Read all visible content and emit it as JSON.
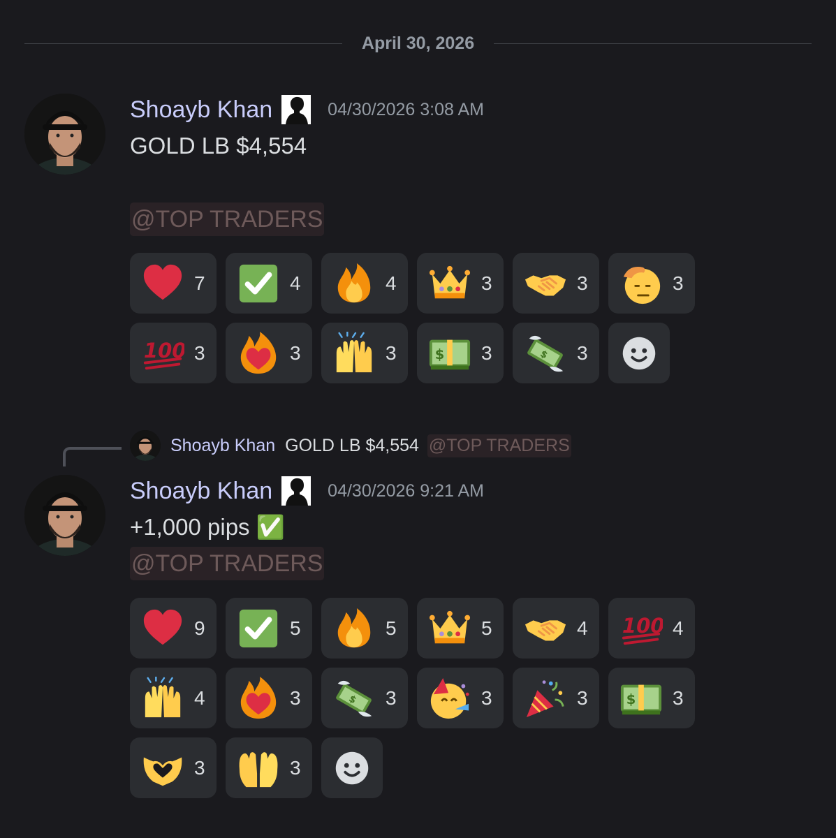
{
  "divider": {
    "date": "April 30, 2026"
  },
  "messages": [
    {
      "author": "Shoayb Khan",
      "timestamp": "04/30/2026 3:08 AM",
      "content": "GOLD LB $4,554",
      "mention": "@TOP TRADERS",
      "reactions": [
        {
          "emoji": "heart",
          "count": "7"
        },
        {
          "emoji": "check-mark",
          "count": "4"
        },
        {
          "emoji": "fire",
          "count": "4"
        },
        {
          "emoji": "crown",
          "count": "3"
        },
        {
          "emoji": "handshake",
          "count": "3"
        },
        {
          "emoji": "saluting-face",
          "count": "3"
        },
        {
          "emoji": "hundred-points",
          "count": "3"
        },
        {
          "emoji": "heart-on-fire",
          "count": "3"
        },
        {
          "emoji": "raising-hands",
          "count": "3"
        },
        {
          "emoji": "dollar-banknote",
          "count": "3"
        },
        {
          "emoji": "money-with-wings",
          "count": "3"
        }
      ]
    },
    {
      "reply": {
        "author": "Shoayb Khan",
        "content": "GOLD LB $4,554",
        "mention": "@TOP TRADERS"
      },
      "author": "Shoayb Khan",
      "timestamp": "04/30/2026 9:21 AM",
      "content": "+1,000 pips ✅",
      "mention": "@TOP TRADERS",
      "reactions": [
        {
          "emoji": "heart",
          "count": "9"
        },
        {
          "emoji": "check-mark",
          "count": "5"
        },
        {
          "emoji": "fire",
          "count": "5"
        },
        {
          "emoji": "crown",
          "count": "5"
        },
        {
          "emoji": "handshake",
          "count": "4"
        },
        {
          "emoji": "hundred-points",
          "count": "4"
        },
        {
          "emoji": "raising-hands",
          "count": "4"
        },
        {
          "emoji": "heart-on-fire",
          "count": "3"
        },
        {
          "emoji": "money-with-wings",
          "count": "3"
        },
        {
          "emoji": "partying-face",
          "count": "3"
        },
        {
          "emoji": "party-popper",
          "count": "3"
        },
        {
          "emoji": "dollar-banknote",
          "count": "3"
        },
        {
          "emoji": "heart-hands",
          "count": "3"
        },
        {
          "emoji": "palms-up-together",
          "count": "3"
        }
      ]
    }
  ],
  "add_reaction_icon": "add-reaction-smiley-icon"
}
